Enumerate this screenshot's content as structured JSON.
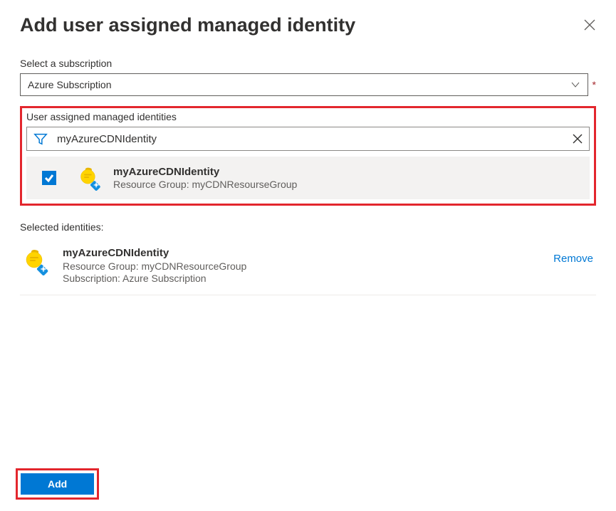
{
  "header": {
    "title": "Add user assigned managed identity"
  },
  "subscription": {
    "label": "Select a subscription",
    "value": "Azure Subscription"
  },
  "identities": {
    "label": "User assigned managed identities",
    "filter_value": "myAzureCDNIdentity",
    "results": [
      {
        "name": "myAzureCDNIdentity",
        "resource_group_label": "Resource Group: myCDNResourseGroup",
        "checked": true
      }
    ]
  },
  "selected": {
    "label": "Selected identities:",
    "items": [
      {
        "name": "myAzureCDNIdentity",
        "resource_group_line": "Resource Group: myCDNResourceGroup",
        "subscription_line": "Subscription: Azure Subscription"
      }
    ],
    "remove_label": "Remove"
  },
  "footer": {
    "add_label": "Add"
  }
}
